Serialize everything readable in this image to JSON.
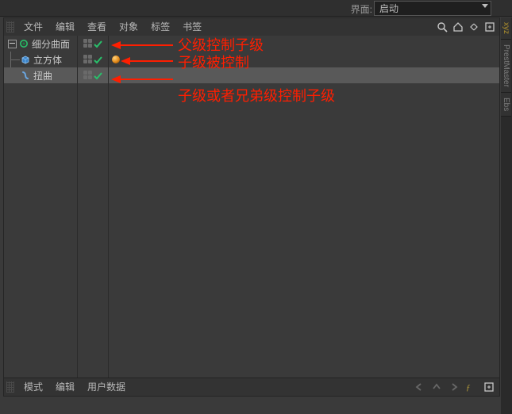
{
  "topstrip": {
    "label": "界面:",
    "dropdown_value": "启动"
  },
  "object_manager": {
    "menu": [
      "文件",
      "编辑",
      "查看",
      "对象",
      "标签",
      "书签"
    ],
    "toolbar_icons": [
      "search-icon",
      "home-icon",
      "expand-icon",
      "pin-icon"
    ],
    "tree": [
      {
        "name": "细分曲面",
        "icon": "subdivision",
        "depth": 0,
        "expanded": true,
        "selected": false,
        "vis": true,
        "chk": true,
        "tags": []
      },
      {
        "name": "立方体",
        "icon": "cube",
        "depth": 1,
        "expanded": false,
        "selected": false,
        "vis": true,
        "chk": true,
        "tags": [
          "phong"
        ]
      },
      {
        "name": "扭曲",
        "icon": "twist",
        "depth": 1,
        "expanded": false,
        "selected": true,
        "vis": true,
        "chk": true,
        "tags": []
      }
    ]
  },
  "attribute_manager": {
    "menu": [
      "模式",
      "编辑",
      "用户数据"
    ],
    "nav_icons": [
      "arrow-left-icon",
      "arrow-up-icon",
      "arrow-right-icon",
      "function-icon",
      "pin-icon"
    ]
  },
  "rightdock_tabs": [
    "xyz",
    "PrestMaster",
    "Ebs"
  ],
  "annotations": {
    "a1": "父级控制子级",
    "a2": "子级被控制",
    "a3": "子级或者兄弟级控制子级"
  }
}
